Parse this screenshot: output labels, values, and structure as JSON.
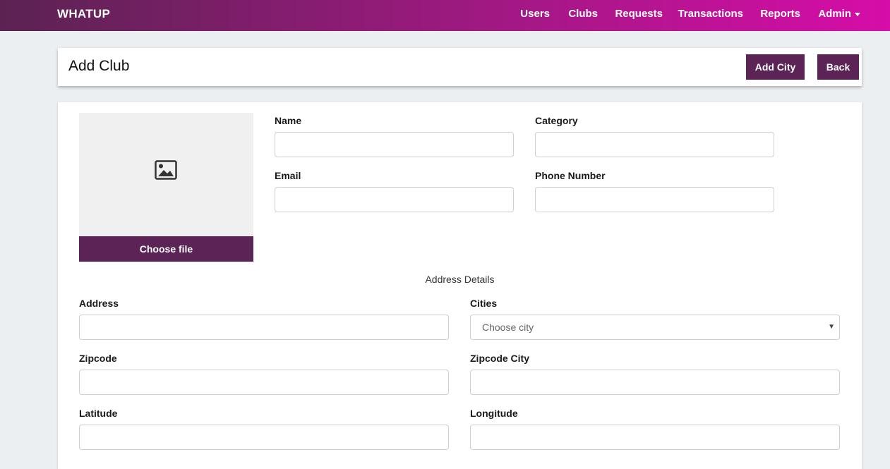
{
  "navbar": {
    "brand": "WHATUP",
    "links": [
      "Users",
      "Clubs",
      "Requests",
      "Transactions",
      "Reports",
      "Admin"
    ]
  },
  "header": {
    "title": "Add Club",
    "add_city_label": "Add City",
    "back_label": "Back"
  },
  "image_upload": {
    "choose_file_label": "Choose file"
  },
  "form": {
    "name_label": "Name",
    "category_label": "Category",
    "email_label": "Email",
    "phone_label": "Phone Number",
    "section_title": "Address Details",
    "address_label": "Address",
    "cities_label": "Cities",
    "cities_placeholder": "Choose city",
    "zipcode_label": "Zipcode",
    "zipcode_city_label": "Zipcode City",
    "latitude_label": "Latitude",
    "longitude_label": "Longitude",
    "values": {
      "name": "",
      "category": "",
      "email": "",
      "phone": "",
      "address": "",
      "zipcode": "",
      "zipcode_city": "",
      "latitude": "",
      "longitude": ""
    }
  },
  "colors": {
    "accent": "#5c2456",
    "nav_gradient_start": "#5b2352",
    "nav_gradient_end": "#d60da8",
    "page_bg": "#eceff1"
  },
  "icons": {
    "image_placeholder": "image-icon",
    "admin_dropdown": "caret-down-icon",
    "select_arrow": "chevron-down-icon"
  }
}
